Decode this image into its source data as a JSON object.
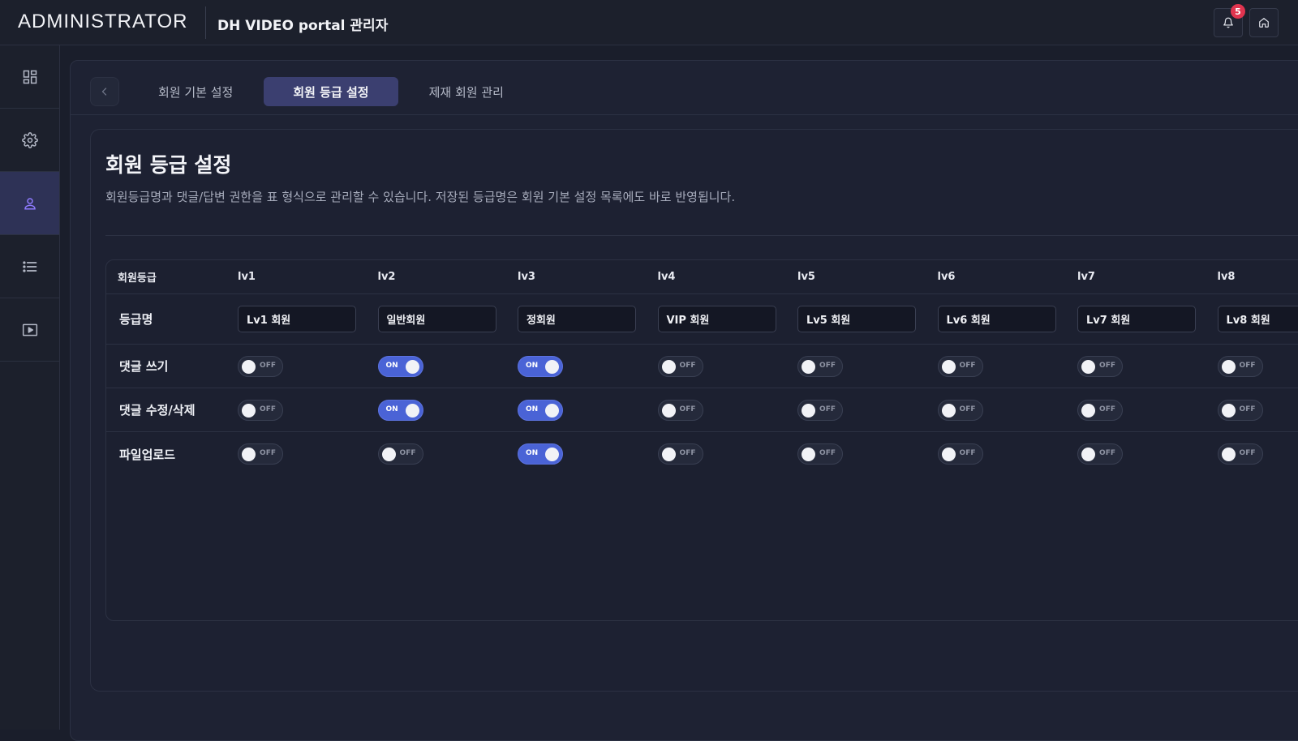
{
  "header": {
    "brand": "ADMINISTRATOR",
    "portal_title": "DH VIDEO portal 관리자",
    "notification_count": "5"
  },
  "sidebar": {
    "items": [
      {
        "icon": "dashboard-icon",
        "active": false
      },
      {
        "icon": "gear-icon",
        "active": false
      },
      {
        "icon": "user-icon",
        "active": true
      },
      {
        "icon": "list-icon",
        "active": false
      },
      {
        "icon": "video-play-icon",
        "active": false
      }
    ]
  },
  "tabs": [
    {
      "label": "회원 기본 설정",
      "active": false
    },
    {
      "label": "회원 등급 설정",
      "active": true
    },
    {
      "label": "제재 회원 관리",
      "active": false
    }
  ],
  "panel": {
    "title": "회원 등급 설정",
    "description": "회원등급명과 댓글/답변 권한을 표 형식으로 관리할 수 있습니다. 저장된 등급명은 회원 기본 설정 목록에도 바로 반영됩니다."
  },
  "table": {
    "header_label": "회원등급",
    "levels": [
      "lv1",
      "lv2",
      "lv3",
      "lv4",
      "lv5",
      "lv6",
      "lv7",
      "lv8"
    ],
    "name_row_label": "등급명",
    "names": [
      "Lv1 회원",
      "일반회원",
      "정회원",
      "VIP 회원",
      "Lv5 회원",
      "Lv6 회원",
      "Lv7 회원",
      "Lv8 회원"
    ],
    "on_label": "ON",
    "off_label": "OFF",
    "permissions": [
      {
        "label": "댓글 쓰기",
        "values": [
          false,
          true,
          true,
          false,
          false,
          false,
          false,
          false
        ]
      },
      {
        "label": "댓글 수정/삭제",
        "values": [
          false,
          true,
          true,
          false,
          false,
          false,
          false,
          false
        ]
      },
      {
        "label": "파일업로드",
        "values": [
          false,
          false,
          true,
          false,
          false,
          false,
          false,
          false
        ]
      }
    ]
  },
  "colors": {
    "accent": "#4a63d6",
    "active_tab": "#3b3f70",
    "badge": "#e0344f"
  }
}
